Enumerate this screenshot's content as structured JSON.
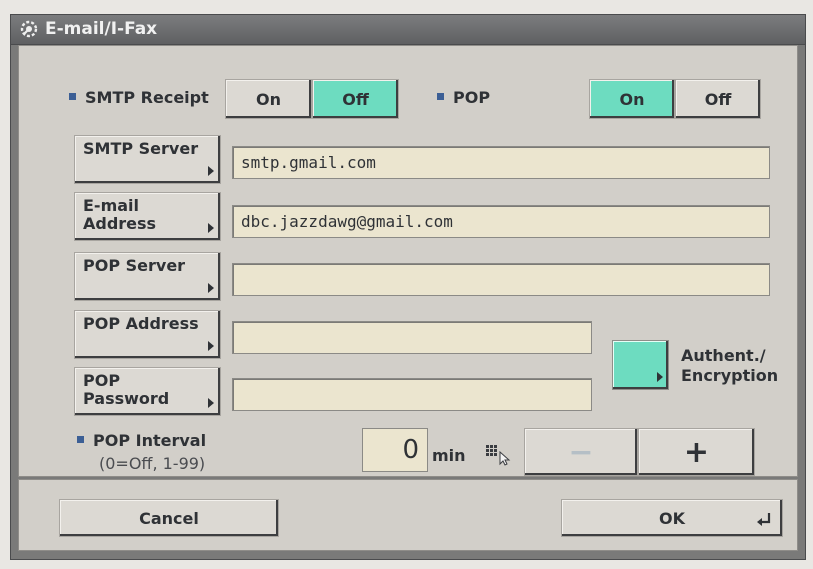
{
  "window": {
    "title": "E-mail/I-Fax",
    "icon": "gear-wrench-icon"
  },
  "smtp_receipt": {
    "label": "SMTP Receipt",
    "on": "On",
    "off": "Off",
    "selected": "Off"
  },
  "pop": {
    "label": "POP",
    "on": "On",
    "off": "Off",
    "selected": "On"
  },
  "fields": [
    {
      "button_line1": "SMTP Server",
      "button_line2": "",
      "value": "smtp.gmail.com"
    },
    {
      "button_line1": "E-mail",
      "button_line2": "Address",
      "value": "dbc.jazzdawg@gmail.com"
    },
    {
      "button_line1": "POP Server",
      "button_line2": "",
      "value": ""
    },
    {
      "button_line1": "POP Address",
      "button_line2": "",
      "value": ""
    },
    {
      "button_line1": "POP",
      "button_line2": "Password",
      "value": ""
    }
  ],
  "auth": {
    "line1": "Authent./",
    "line2": "Encryption"
  },
  "pop_interval": {
    "label": "POP Interval",
    "hint": "(0=Off, 1-99)",
    "value": "0",
    "unit": "min",
    "minus": "−",
    "plus": "+"
  },
  "footer": {
    "cancel": "Cancel",
    "ok": "OK"
  },
  "colors": {
    "selected": "#6ddcc0",
    "panel": "#d2cfc9",
    "field": "#ebe5cf",
    "bullet": "#3c5f95"
  }
}
